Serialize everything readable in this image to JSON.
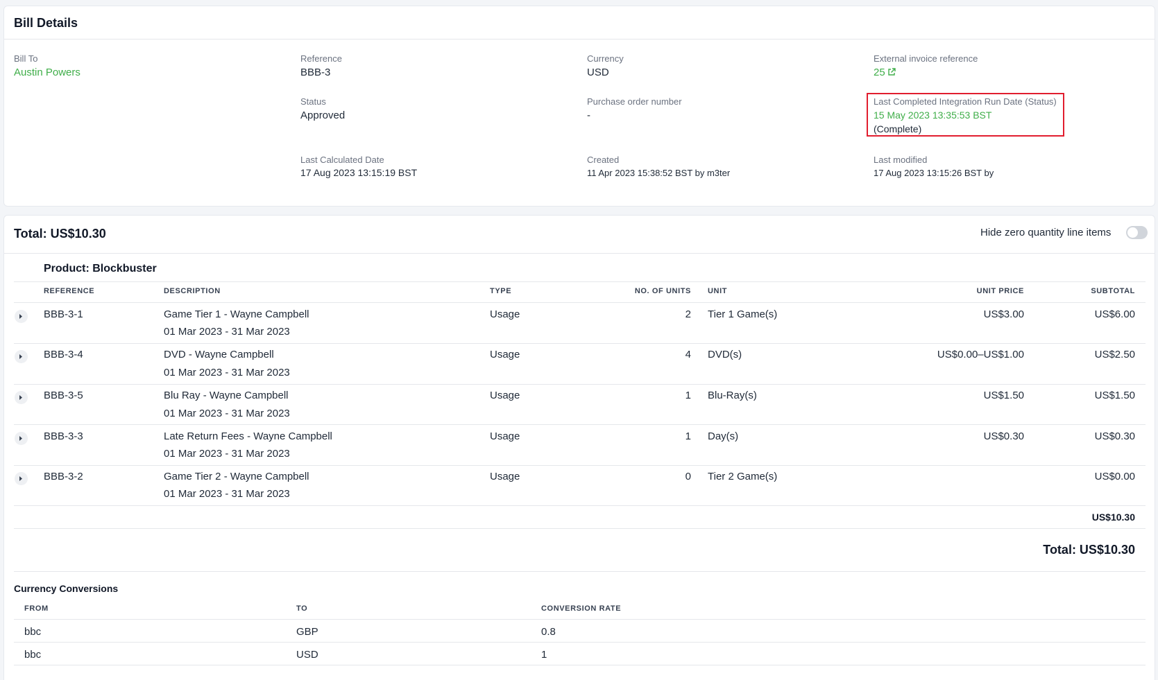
{
  "bill_details": {
    "title": "Bill Details",
    "bill_to": {
      "label": "Bill To",
      "value": "Austin Powers"
    },
    "reference": {
      "label": "Reference",
      "value": "BBB-3"
    },
    "currency": {
      "label": "Currency",
      "value": "USD"
    },
    "external_ref": {
      "label": "External invoice reference",
      "value": "25"
    },
    "status": {
      "label": "Status",
      "value": "Approved"
    },
    "po_number": {
      "label": "Purchase order number",
      "value": "-"
    },
    "integration": {
      "label": "Last Completed Integration Run Date (Status)",
      "date": "15 May 2023 13:35:53 BST",
      "status": "(Complete)"
    },
    "last_calculated": {
      "label": "Last Calculated Date",
      "value": "17 Aug 2023 13:15:19 BST"
    },
    "created": {
      "label": "Created",
      "value": "11 Apr 2023 15:38:52 BST by m3ter"
    },
    "last_modified": {
      "label": "Last modified",
      "value": "17 Aug 2023 13:15:26 BST by"
    }
  },
  "totals": {
    "header": "Total: US$10.30",
    "toggle_label": "Hide zero quantity line items",
    "toggle_on": false,
    "product_subtotal": "US$10.30",
    "grand_total": "Total: US$10.30"
  },
  "product": {
    "title": "Product: Blockbuster",
    "columns": {
      "reference": "REFERENCE",
      "description": "DESCRIPTION",
      "type": "TYPE",
      "units": "NO. OF UNITS",
      "unit": "UNIT",
      "unit_price": "UNIT PRICE",
      "subtotal": "SUBTOTAL"
    },
    "rows": [
      {
        "reference": "BBB-3-1",
        "description": "Game Tier 1 - Wayne Campbell",
        "period": "01 Mar 2023 - 31 Mar 2023",
        "type": "Usage",
        "units": "2",
        "unit": "Tier 1 Game(s)",
        "unit_price": "US$3.00",
        "subtotal": "US$6.00"
      },
      {
        "reference": "BBB-3-4",
        "description": "DVD - Wayne Campbell",
        "period": "01 Mar 2023 - 31 Mar 2023",
        "type": "Usage",
        "units": "4",
        "unit": "DVD(s)",
        "unit_price": "US$0.00–US$1.00",
        "subtotal": "US$2.50"
      },
      {
        "reference": "BBB-3-5",
        "description": "Blu Ray - Wayne Campbell",
        "period": "01 Mar 2023 - 31 Mar 2023",
        "type": "Usage",
        "units": "1",
        "unit": "Blu-Ray(s)",
        "unit_price": "US$1.50",
        "subtotal": "US$1.50"
      },
      {
        "reference": "BBB-3-3",
        "description": "Late Return Fees - Wayne Campbell",
        "period": "01 Mar 2023 - 31 Mar 2023",
        "type": "Usage",
        "units": "1",
        "unit": "Day(s)",
        "unit_price": "US$0.30",
        "subtotal": "US$0.30"
      },
      {
        "reference": "BBB-3-2",
        "description": "Game Tier 2 - Wayne Campbell",
        "period": "01 Mar 2023 - 31 Mar 2023",
        "type": "Usage",
        "units": "0",
        "unit": "Tier 2 Game(s)",
        "unit_price": "",
        "subtotal": "US$0.00"
      }
    ]
  },
  "conversions": {
    "title": "Currency Conversions",
    "columns": {
      "from": "FROM",
      "to": "TO",
      "rate": "CONVERSION RATE"
    },
    "rows": [
      {
        "from": "bbc",
        "to": "GBP",
        "rate": "0.8"
      },
      {
        "from": "bbc",
        "to": "USD",
        "rate": "1"
      }
    ]
  },
  "colors": {
    "accent_green": "#3fae49",
    "highlight_red": "#e11d2e"
  },
  "icons": {
    "external_link": "external-link-icon",
    "expand": "caret-right-icon"
  }
}
